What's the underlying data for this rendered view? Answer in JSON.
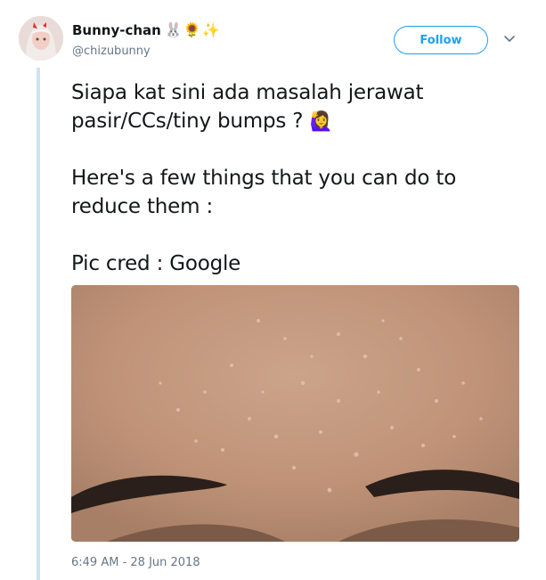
{
  "user": {
    "display_name": "Bunny-chan",
    "name_emojis": "🐰🌻✨",
    "handle": "@chizubunny"
  },
  "actions": {
    "follow_label": "Follow",
    "more_icon": "chevron-down-icon"
  },
  "tweet": {
    "line1": "Siapa kat sini ada masalah jerawat",
    "line2": "pasir/CCs/tiny bumps ? ",
    "line2_emoji": "🙋‍♀️",
    "line3": "Here's a few things that you can do to",
    "line4": "reduce them :",
    "line5": "Pic cred : Google",
    "timestamp": "6:49 AM - 28 Jun 2018"
  },
  "colors": {
    "accent": "#1da1f2",
    "secondary_text": "#657786",
    "thread_line": "#cfe3f1"
  }
}
